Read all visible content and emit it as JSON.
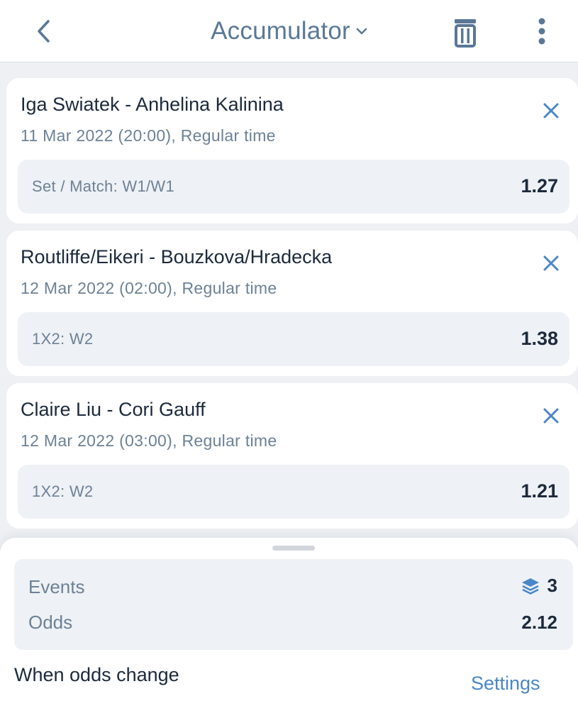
{
  "header": {
    "title": "Accumulator"
  },
  "colors": {
    "accent": "#4a86c8",
    "header_text": "#5a7896",
    "primary_text": "#1c2a3c",
    "secondary_text": "#6d8196",
    "background": "#eef0f4"
  },
  "icons": {
    "back": "chevron-left-icon",
    "title_dropdown": "chevron-down-icon",
    "delete": "trash-icon",
    "more": "more-vertical-icon",
    "remove_bet": "close-icon",
    "events": "layers-icon"
  },
  "bets": [
    {
      "match": "Iga Swiatek - Anhelina Kalinina",
      "time": "11 Mar 2022 (20:00), Regular time",
      "market": "Set / Match: W1/W1",
      "odds": "1.27"
    },
    {
      "match": "Routliffe/Eikeri - Bouzkova/Hradecka",
      "time": "12 Mar 2022 (02:00), Regular time",
      "market": "1X2: W2",
      "odds": "1.38"
    },
    {
      "match": "Claire Liu - Cori Gauff",
      "time": "12 Mar 2022 (03:00), Regular time",
      "market": "1X2: W2",
      "odds": "1.21"
    }
  ],
  "summary": {
    "events_label": "Events",
    "events_count": "3",
    "odds_label": "Odds",
    "odds_value": "2.12"
  },
  "footer": {
    "odds_change_label": "When odds change",
    "settings_label": "Settings"
  }
}
